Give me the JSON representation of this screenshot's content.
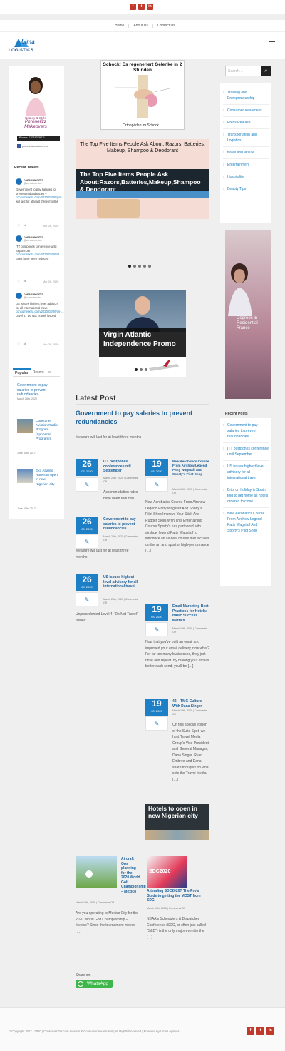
{
  "nav": {
    "links": [
      "Home",
      "About Us",
      "Contact Us"
    ]
  },
  "logo": {
    "text1": "Lima",
    "text2": "LOGISTICS"
  },
  "left": {
    "profile": {
      "caption1": "Beauty & Style",
      "caption2": "Phronelizz Makeovers",
      "phone": "Phone: 07031379711",
      "fb": "phronelizzmakeovers"
    },
    "recent_tweets_title": "Recent Tweets",
    "tweets": [
      {
        "user": "consumerxtra",
        "handle": "@consumerxtra",
        "text": "Government to pay salaries to prevent redundancies –",
        "link": "consumerxtra.com/2020/03/26/gov…",
        "rest": "will last for at least three months",
        "date": "Mar 26, 2020"
      },
      {
        "user": "consumerxtra",
        "handle": "@consumerxtra",
        "text": "ITT postpones conference until September",
        "link": "consumerxtra.com/2020/03/26/itt…",
        "rest": "rates have been reduced",
        "date": "Mar 26, 2020"
      },
      {
        "user": "consumerxtra",
        "handle": "@consumerxtra",
        "text": "US issues highest level advisory for all international travel –",
        "link": "consumerxtra.com/2020/03/26/us-…",
        "rest": "Level 4: 'Do Not Travel' issued",
        "date": "Mar 26, 2020"
      }
    ],
    "tabs": {
      "popular": "Popular",
      "recent": "Recent"
    },
    "popular": [
      {
        "title": "Government to pay salaries to prevent redundancies",
        "date": "March 26th, 2020"
      },
      {
        "title": "Consumer Aviation Radio Program [Sponsore Programm",
        "date": "June 30th, 2017"
      },
      {
        "title": "Eko Atlantic Hotels to open in new Nigerian city",
        "date": "June 30th, 2017"
      }
    ]
  },
  "center": {
    "ad1": {
      "title": "Schock! Es regeneriert Gelenke in 2 Stunden",
      "caption": "Orthopäden im Schock…"
    },
    "slide1": {
      "header": "The Top Five Items People Ask About: Razors, Batteries, Makeup, Shampoo & Deodorant",
      "overlay": "The Top Five Items People Ask About:Razors,Batteries,Makeup,Shampoo & Deodorant"
    },
    "slide2": {
      "overlay": "Virgin Atlantic Independence Promo"
    },
    "latest_title": "Latest Post",
    "featured": {
      "title": "Government to pay salaries to prevent redundancies",
      "excerpt": "Measure will last for at least three months"
    },
    "left_posts": [
      {
        "day": "26",
        "mon": "03, 2020",
        "title": "ITT postpones conference until September",
        "meta": "March 26th, 2020 | Comments Off",
        "excerpt": "Accommodation rates have been reduced"
      },
      {
        "day": "26",
        "mon": "03, 2020",
        "title": "Government to pay salaries to prevent redundancies",
        "meta": "March 26th, 2020 | Comments Off",
        "excerpt": "Measure will last for at least three months"
      },
      {
        "day": "26",
        "mon": "03, 2020",
        "title": "US issues highest level advisory for all international travel",
        "meta": "March 26th, 2020 | Comments Off",
        "excerpt": "Unprecedented Level 4: 'Do Not Travel' issued"
      }
    ],
    "right_posts": [
      {
        "day": "19",
        "mon": "03, 2020",
        "title": "New Aerobatics Course From Airshow Legend Patty Wagstaff And Sporty's Pilot Shop",
        "meta": "March 19th, 2020 | Comments Off",
        "excerpt": "New Aerobatics Course From Airshow Legend Patty Wagstaff And Sporty's Pilot Shop Improve Your Stick And Rudder Skills With This Entertaining Course Sporty's has partnered with airshow legend Patty Wagstaff to introduce an all-new course that focuses on the art and sport of high-performance […]"
      },
      {
        "day": "19",
        "mon": "03, 2020",
        "title": "Email Marketing Best Practices for Hotels: Basic Success Metrics",
        "meta": "March 19th, 2020 | Comments Off",
        "excerpt": "Now that you've built an email and improved your email delivery, now what? For far too many businesses, they just rinse and repeat. By making your emails better each send, you'll be […]"
      },
      {
        "day": "19",
        "mon": "03, 2020",
        "title": "42 – TMG Culture With Dana Singer",
        "meta": "March 19th, 2020 | Comments Off",
        "excerpt": "On this special edition of the Suite Spot, we host Travel Media Group's Vice President and General Manager, Dana Singer. Ryan Embree and Dana share thoughts on what sets the Travel Media […]"
      }
    ],
    "hotels_img": "Hotels to open in new Nigerian city",
    "bottom_posts": [
      {
        "title": "Aircraft Ops planning for the 2020 World Golf Championship – Mexico",
        "meta": "March 19th, 2020 | Comments Off",
        "excerpt": "Are you operating to Mexico City for the 2020 World Golf Championship – Mexico? Since the tournament moved […]"
      },
      {
        "title": "Attending SDC2020? The Pro's Guide to getting the MOST from SDC.",
        "meta": "March 19th, 2020 | Comments Off",
        "excerpt": "NBAA's Schedulers & Dispatcher Conference (SDC, or often just called \"S&D\") is the only major event in the […]",
        "img": "SDC2020"
      }
    ],
    "share": "Share on:",
    "whatsapp": "WhatsApp"
  },
  "right": {
    "search_placeholder": "Search…",
    "categories": [
      "Training and Entrepreneurship",
      "Consumer awareness",
      "Press Release",
      "Transportation and Logistics",
      "travel and leisure",
      "Entertainment",
      "Hospitality",
      "Beauty Tips"
    ],
    "ad_text": "Degrees in Residential France",
    "recent_title": "Recent Posts",
    "recent": [
      "Government to pay salaries to prevent redundancies",
      "ITT postpones conference until September",
      "US issues highest level advisory for all international travel",
      "Brits on holiday in Spain told to get home as hotels ordered to close",
      "New Aerobatics Course From Airshow Legend Patty Wagstaff And Sporty's Pilot Shop"
    ]
  },
  "footer": {
    "copyright": "© Copyright 2017 - 2020   |   Consumerxtra.com Aviation & Consumer Awareness   |   All Rights Reserved   |   Powered by Lima Logistics"
  },
  "social": [
    "f",
    "t",
    "in"
  ],
  "colors": {
    "accent": "#1d7fc5",
    "social": "#c0392b"
  }
}
